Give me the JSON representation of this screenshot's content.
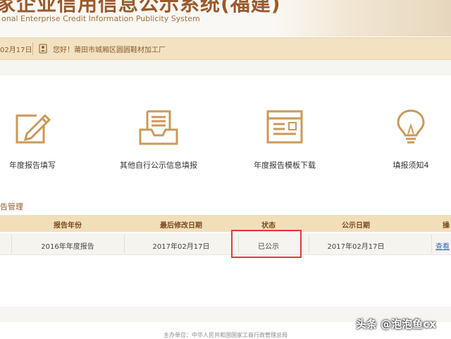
{
  "header": {
    "title_cn": "家企业信用信息公示系统(福建)",
    "title_en": "onal Enterprise Credit Information Publicity System"
  },
  "bar": {
    "date": "02月17日",
    "greeting": "您好！莆田市城厢区圆圆鞋材加工厂",
    "logout": ""
  },
  "actions": [
    {
      "label": "年度报告填写",
      "icon": "pencil-edit-icon"
    },
    {
      "label": "其他自行公示信息填报",
      "icon": "inbox-tray-icon"
    },
    {
      "label": "年度报告模板下载",
      "icon": "document-template-icon"
    },
    {
      "label": "填报须知4",
      "icon": "lightbulb-icon"
    }
  ],
  "section": {
    "title": "告管理"
  },
  "table": {
    "headers": [
      "报告年份",
      "最后修改日期",
      "状态",
      "公示日期",
      "操"
    ],
    "rows": [
      {
        "year": "2016年年度报告",
        "modified": "2017年02月17日",
        "status": "已公示",
        "published": "2017年02月17日",
        "action": "查看"
      }
    ]
  },
  "footer": {
    "text": "主办单位：中华人民共和国国家工商行政管理总局"
  },
  "watermark": {
    "text": "头条 @泡泡鱼cx"
  },
  "colors": {
    "accent": "#9a5a2c",
    "bar_bg": "#f3e2c1",
    "table_head": "#f2dfba",
    "highlight": "#e23a3a"
  }
}
